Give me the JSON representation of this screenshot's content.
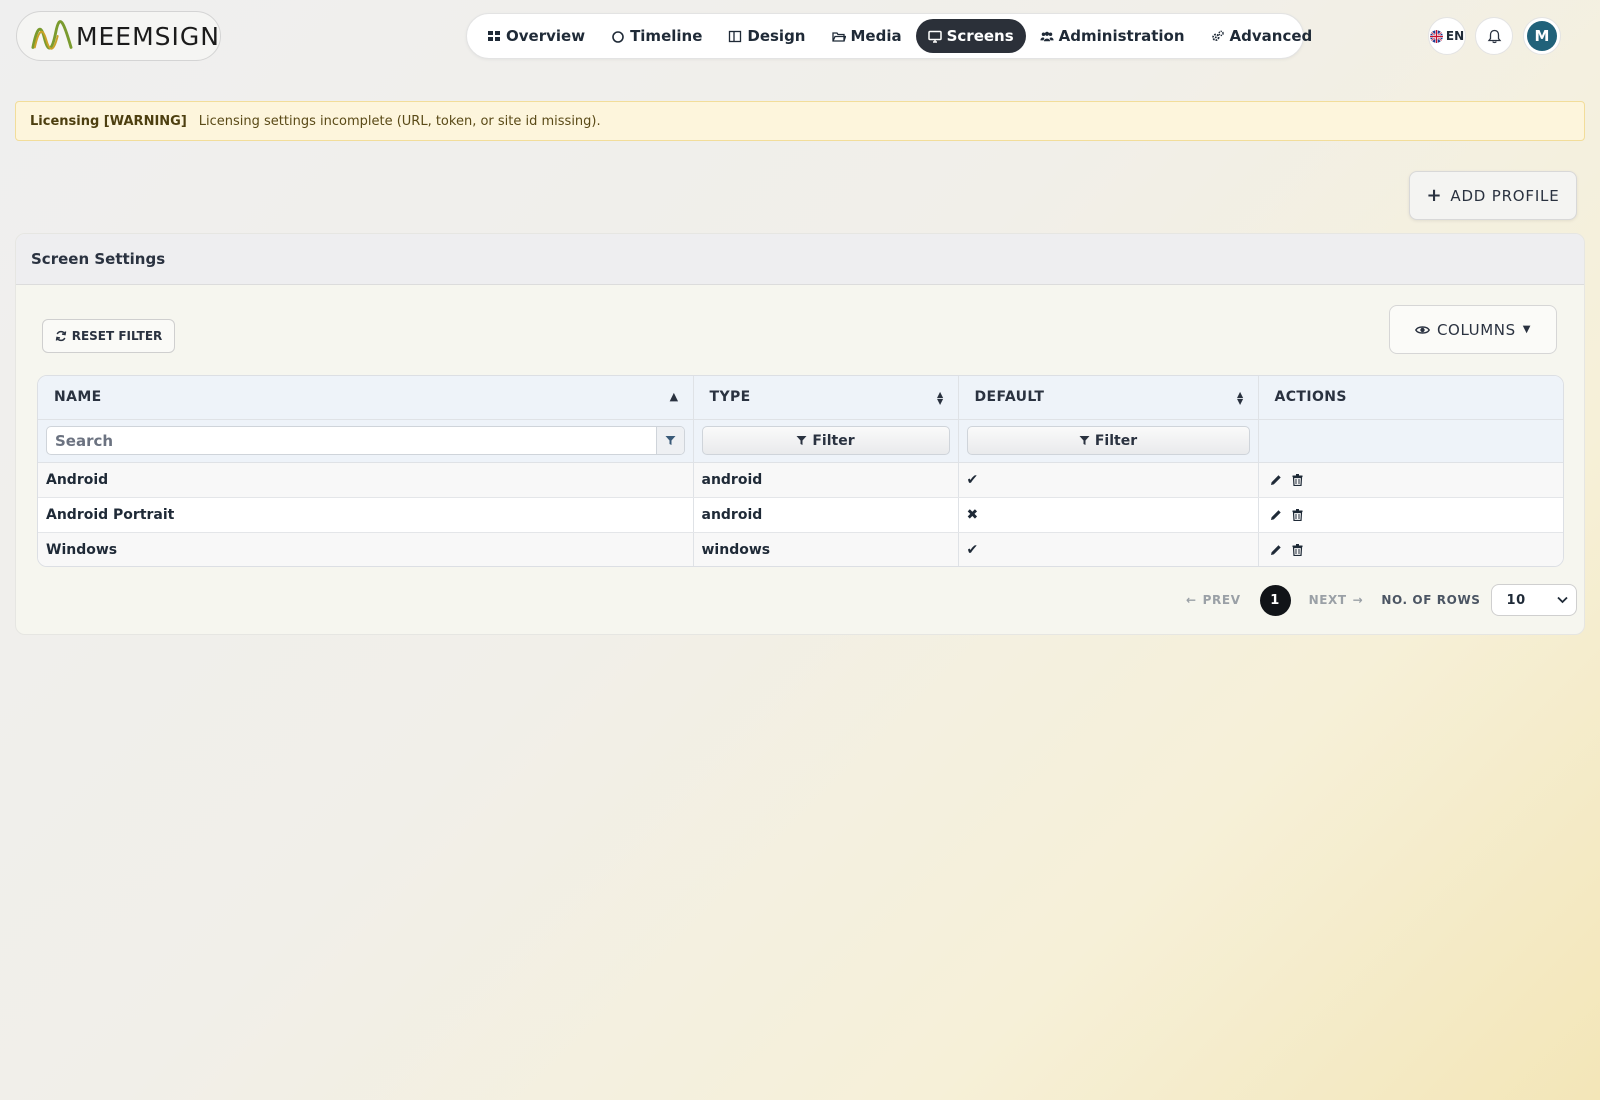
{
  "app": {
    "logo_text": "MEEMSIGN"
  },
  "nav": {
    "items": [
      {
        "label": "Overview",
        "icon": "grid-icon"
      },
      {
        "label": "Timeline",
        "icon": "circle-icon"
      },
      {
        "label": "Design",
        "icon": "columns-icon"
      },
      {
        "label": "Media",
        "icon": "folder-icon"
      },
      {
        "label": "Screens",
        "icon": "monitor-icon",
        "active": true
      },
      {
        "label": "Administration",
        "icon": "users-icon"
      },
      {
        "label": "Advanced",
        "icon": "gears-icon"
      }
    ]
  },
  "header_actions": {
    "language": "EN",
    "avatar_initial": "M"
  },
  "alert": {
    "title": "Licensing [WARNING]",
    "message": "Licensing settings incomplete (URL, token, or site id missing)."
  },
  "toolbar": {
    "add_profile_label": "ADD PROFILE"
  },
  "card": {
    "title": "Screen Settings",
    "reset_filter_label": "RESET FILTER",
    "columns_label": "COLUMNS"
  },
  "table": {
    "columns": [
      {
        "label": "NAME",
        "sort": "asc"
      },
      {
        "label": "TYPE",
        "sort": "both"
      },
      {
        "label": "DEFAULT",
        "sort": "both"
      },
      {
        "label": "ACTIONS",
        "sort": "none"
      }
    ],
    "search_placeholder": "Search",
    "filter_label": "Filter",
    "rows": [
      {
        "name": "Android",
        "type": "android",
        "default": true
      },
      {
        "name": "Android Portrait",
        "type": "android",
        "default": false
      },
      {
        "name": "Windows",
        "type": "windows",
        "default": true
      }
    ]
  },
  "pagination": {
    "prev_label": "PREV",
    "next_label": "NEXT",
    "current_page": "1",
    "rows_label": "NO. OF ROWS",
    "rows_value": "10"
  },
  "colors": {
    "active_nav": "#2b3039",
    "avatar": "#21627a",
    "alert_bg": "#fdf5dc"
  }
}
